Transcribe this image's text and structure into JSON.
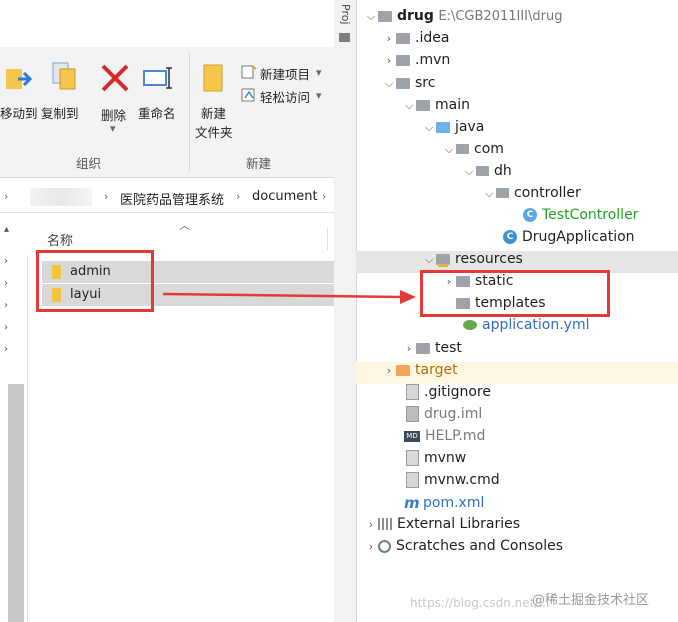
{
  "explorer": {
    "ribbon": {
      "move_label": "移动到",
      "copy_label": "复制到",
      "delete_label": "删除",
      "rename_label": "重命名",
      "new_folder_line1": "新建",
      "new_folder_line2": "文件夹",
      "new_item_label": "新建项目",
      "easy_access_label": "轻松访问",
      "group_organize": "组织",
      "group_new": "新建"
    },
    "address": {
      "crumbs": [
        "医院药品管理系统",
        "document"
      ]
    },
    "column_header": "名称",
    "files": [
      {
        "name": "admin"
      },
      {
        "name": "layui"
      }
    ]
  },
  "ide": {
    "sidebar_tab": "Proj",
    "tree": [
      {
        "label": "drug",
        "extra": "E:\\CGB2011III\\drug",
        "icon": "grey-folder-icon"
      },
      {
        "label": ".idea",
        "icon": "grey-folder-icon"
      },
      {
        "label": ".mvn",
        "icon": "grey-folder-icon"
      },
      {
        "label": "src",
        "icon": "grey-folder-icon"
      },
      {
        "label": "main",
        "icon": "grey-folder-icon"
      },
      {
        "label": "java",
        "icon": "blue-source-folder-icon"
      },
      {
        "label": "com",
        "icon": "package-icon"
      },
      {
        "label": "dh",
        "icon": "package-icon"
      },
      {
        "label": "controller",
        "icon": "package-icon"
      },
      {
        "label": "TestController",
        "icon": "java-class-icon"
      },
      {
        "label": "DrugApplication",
        "icon": "spring-class-icon"
      },
      {
        "label": "resources",
        "icon": "resources-folder-icon"
      },
      {
        "label": "static",
        "icon": "grey-folder-icon"
      },
      {
        "label": "templates",
        "icon": "grey-folder-icon"
      },
      {
        "label": "application.yml",
        "icon": "yml-file-icon"
      },
      {
        "label": "test",
        "icon": "grey-folder-icon"
      },
      {
        "label": "target",
        "icon": "orange-folder-icon"
      },
      {
        "label": ".gitignore",
        "icon": "file-icon"
      },
      {
        "label": "drug.iml",
        "icon": "iml-file-icon"
      },
      {
        "label": "HELP.md",
        "icon": "markdown-file-icon"
      },
      {
        "label": "mvnw",
        "icon": "file-icon"
      },
      {
        "label": "mvnw.cmd",
        "icon": "file-icon"
      },
      {
        "label": "pom.xml",
        "icon": "maven-icon"
      },
      {
        "label": "External Libraries",
        "icon": "libraries-icon"
      },
      {
        "label": "Scratches and Consoles",
        "icon": "scratches-icon"
      }
    ]
  },
  "watermark": {
    "url": "https://blog.csdn.net/...",
    "brand": "@稀土掘金技术社区"
  },
  "colors": {
    "highlight_red": "#e53935",
    "class_green": "#22a022",
    "link_blue": "#2f6fbf",
    "target_orange": "#b0700a"
  }
}
